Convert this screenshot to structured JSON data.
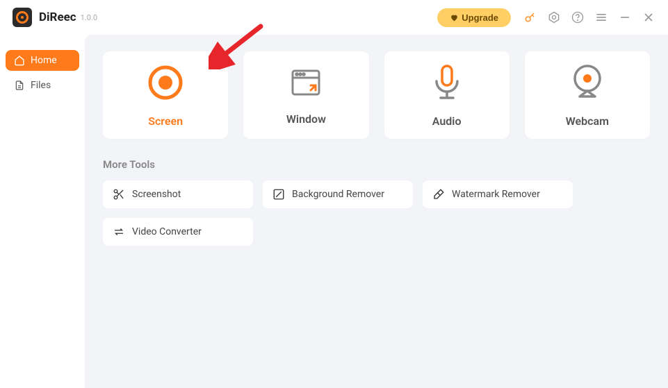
{
  "app": {
    "name": "DiReec",
    "version": "1.0.0"
  },
  "titlebar": {
    "upgrade": "Upgrade"
  },
  "sidebar": {
    "items": [
      {
        "label": "Home",
        "active": true
      },
      {
        "label": "Files",
        "active": false
      }
    ]
  },
  "main": {
    "cards": [
      {
        "label": "Screen",
        "active": true
      },
      {
        "label": "Window",
        "active": false
      },
      {
        "label": "Audio",
        "active": false
      },
      {
        "label": "Webcam",
        "active": false
      }
    ],
    "more_tools_title": "More Tools",
    "tools": [
      {
        "label": "Screenshot"
      },
      {
        "label": "Background Remover"
      },
      {
        "label": "Watermark Remover"
      },
      {
        "label": "Video Converter"
      }
    ]
  },
  "colors": {
    "accent": "#ff7a1a",
    "upgrade_bg": "#ffcf66"
  }
}
